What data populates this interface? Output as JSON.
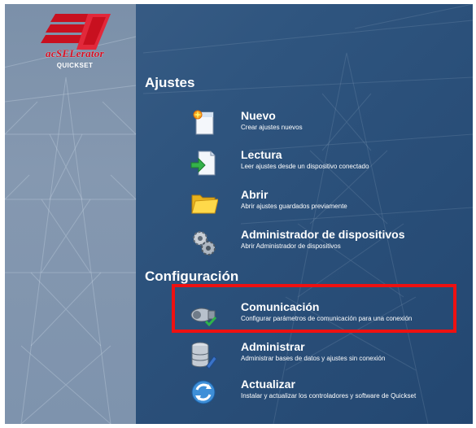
{
  "logo": {
    "brand": "acSELerator",
    "product": "QUICKSET"
  },
  "sections": {
    "ajustes": {
      "title": "Ajustes"
    },
    "configuracion": {
      "title": "Configuración"
    }
  },
  "items": {
    "nuevo": {
      "label": "Nuevo",
      "desc": "Crear ajustes nuevos",
      "icon": "new-document-icon"
    },
    "lectura": {
      "label": "Lectura",
      "desc": "Leer ajustes desde un dispositivo conectado",
      "icon": "read-document-icon"
    },
    "abrir": {
      "label": "Abrir",
      "desc": "Abrir ajustes guardados previamente",
      "icon": "folder-icon"
    },
    "administrador": {
      "label": "Administrador de dispositivos",
      "desc": "Abrir Administrador de dispositivos",
      "icon": "gears-icon"
    },
    "comunicacion": {
      "label": "Comunicación",
      "desc": "Configurar parámetros de comunicación para una conexión",
      "icon": "connector-icon"
    },
    "administrar": {
      "label": "Administrar",
      "desc": "Administrar bases de datos y ajustes sin conexión",
      "icon": "database-icon"
    },
    "actualizar": {
      "label": "Actualizar",
      "desc": "Instalar y actualizar los controladores y software de Quickset",
      "icon": "refresh-icon"
    }
  },
  "colors": {
    "background": "#2f557f",
    "sidebar": "#8598b0",
    "highlight": "#ee1111",
    "brand_red": "#d40f22"
  }
}
